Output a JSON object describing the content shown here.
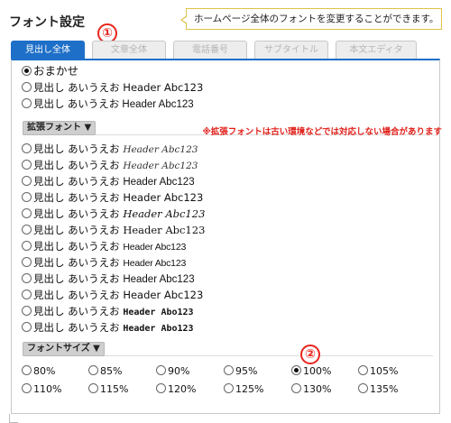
{
  "header": {
    "title": "フォント設定",
    "note": "ホームページ全体のフォントを変更することができます。"
  },
  "markers": {
    "m1": "①",
    "m2": "②"
  },
  "tabs": [
    {
      "label": "見出し全体",
      "active": true
    },
    {
      "label": "文章全体",
      "active": false
    },
    {
      "label": "電話番号",
      "active": false
    },
    {
      "label": "サブタイトル",
      "active": false
    },
    {
      "label": "本文エディタ",
      "active": false
    }
  ],
  "basic": {
    "omakase": "おまかせ",
    "opt1": "見出し あいうえお Header Abc123",
    "opt2": "見出し あいうえお Header Abc123"
  },
  "extended": {
    "label": "拡張フォント ▼",
    "warning": "※拡張フォントは古い環境などでは対応しない場合があります",
    "prefix1": "見出し あいうえお ",
    "prefix2": "見出し あいうえお",
    "items": [
      {
        "jp": "見出し あいうえお ",
        "en": "Header Abc123"
      },
      {
        "jp": "見出し あいうえお ",
        "en": "Header Abc123"
      },
      {
        "jp": "見出し あいうえお ",
        "en": "Header Abc123"
      },
      {
        "jp": "見出し あいうえお ",
        "en": "Header Abc123"
      },
      {
        "jp": "見出し あいうえお ",
        "en": "Header Abc123"
      },
      {
        "jp": "見出し あいうえお ",
        "en": "Header Abc123"
      },
      {
        "jp": "見出し あいうえお ",
        "en": "Header Abc123"
      },
      {
        "jp": "見出し あいうえお ",
        "en": "Header Abc123"
      },
      {
        "jp": "見出し あいうえお ",
        "en": "Header Abc123"
      },
      {
        "jp": "見出し あいうえお ",
        "en": "Header Abc123"
      },
      {
        "jp": "見出し あいうえお ",
        "en": "Header Abo123"
      },
      {
        "jp": "見出し あいうえお ",
        "en": "Header Abo123"
      }
    ]
  },
  "size": {
    "label": "フォントサイズ ▼",
    "options": [
      "80%",
      "85%",
      "90%",
      "95%",
      "100%",
      "105%",
      "110%",
      "115%",
      "120%",
      "125%",
      "130%",
      "135%"
    ],
    "selected": "100%"
  },
  "colors": {
    "accent": "#1e6fc8",
    "warning": "#e0201a",
    "marker": "#e8251d",
    "note_border": "#e0c24a"
  }
}
